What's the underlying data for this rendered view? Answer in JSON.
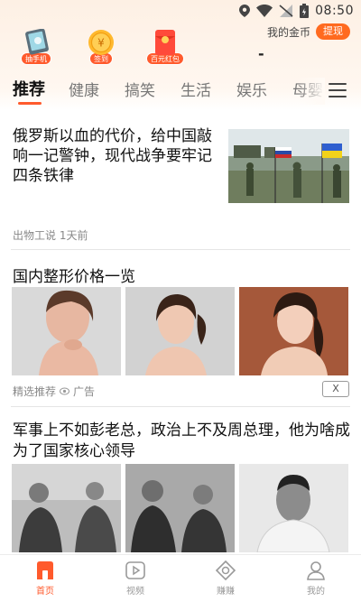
{
  "status_bar": {
    "time": "08:50"
  },
  "promos": [
    {
      "label": "抽手机",
      "icon": "phone-gift-icon"
    },
    {
      "label": "签到",
      "icon": "coin-icon",
      "coin_glyph": "¥"
    },
    {
      "label": "百元红包",
      "icon": "red-envelope-icon"
    }
  ],
  "coins": {
    "label": "我的金币",
    "withdraw": "提现",
    "amount": "-"
  },
  "tabs": [
    "推荐",
    "健康",
    "搞笑",
    "生活",
    "娱乐",
    "母婴"
  ],
  "news": [
    {
      "title": "俄罗斯以血的代价，给中国敲响一记警钟，现代战争要牢记四条铁律",
      "meta": "出物工说  1天前"
    }
  ],
  "ad": {
    "title": "国内整形价格一览",
    "source": "精选推荐",
    "ad_label": "广告",
    "close": "X"
  },
  "news3": {
    "title": "军事上不如彭老总，政治上不及周总理，他为啥成为了国家核心领导"
  },
  "bottom_nav": [
    {
      "label": "首页",
      "icon": "home-icon",
      "active": true
    },
    {
      "label": "视频",
      "icon": "video-icon",
      "active": false
    },
    {
      "label": "赚赚",
      "icon": "earn-icon",
      "active": false
    },
    {
      "label": "我的",
      "icon": "profile-icon",
      "active": false
    }
  ],
  "colors": {
    "accent": "#ff5a2c",
    "header_bg": "#fdf0e4"
  }
}
